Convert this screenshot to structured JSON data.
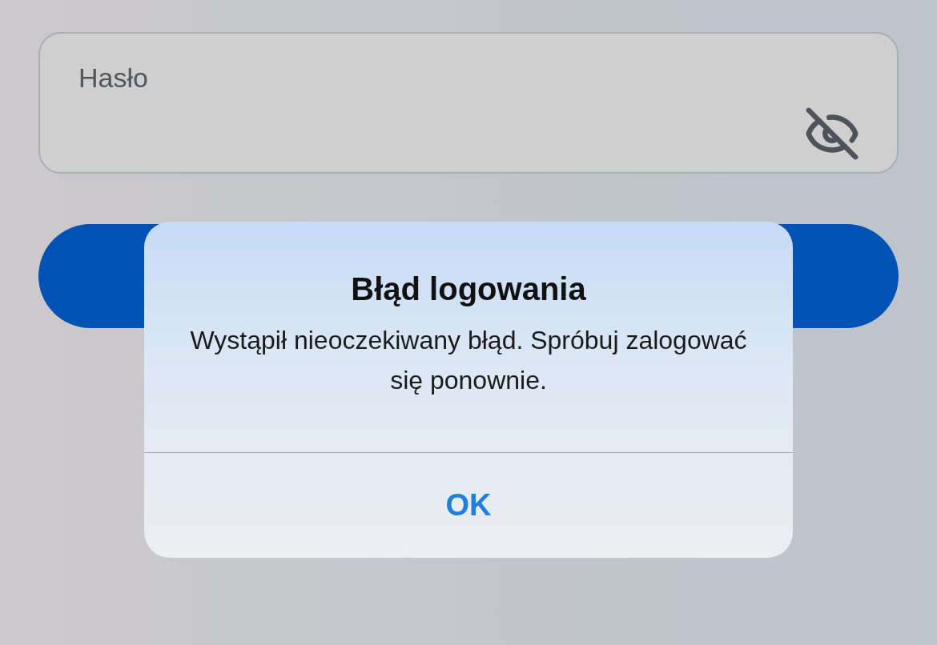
{
  "password_field": {
    "label": "Hasło",
    "show_password": false
  },
  "alert": {
    "title": "Błąd logowania",
    "message": "Wystąpił nieoczekiwany błąd. Spróbuj zalogować się ponownie.",
    "buttons": [
      {
        "label": "OK"
      }
    ]
  }
}
